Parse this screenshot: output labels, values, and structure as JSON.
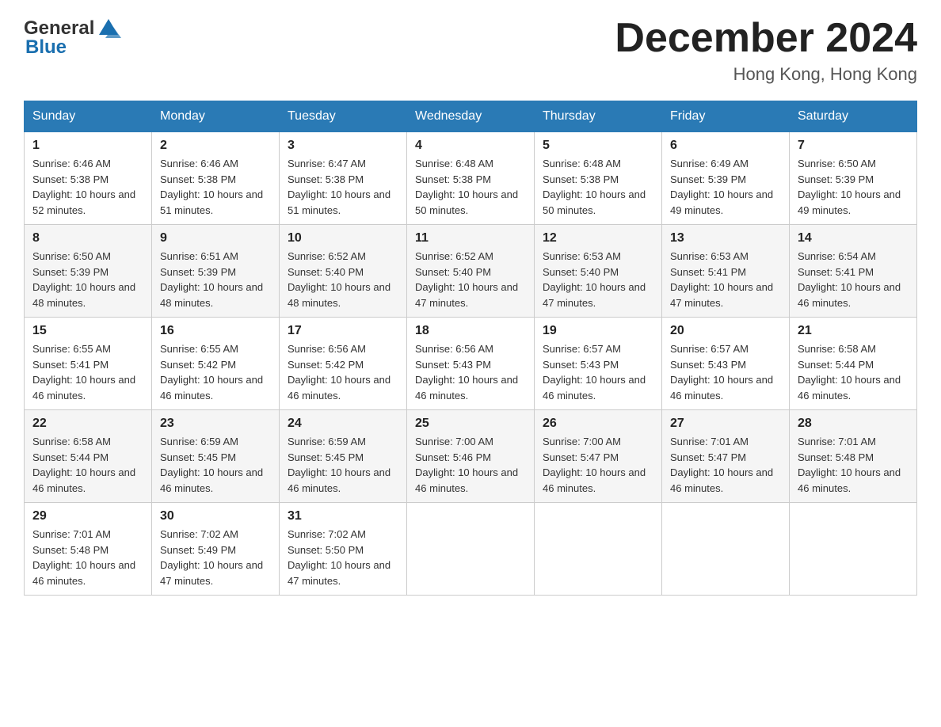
{
  "app": {
    "logo_general": "General",
    "logo_blue": "Blue",
    "month_title": "December 2024",
    "location": "Hong Kong, Hong Kong"
  },
  "calendar": {
    "days_of_week": [
      "Sunday",
      "Monday",
      "Tuesday",
      "Wednesday",
      "Thursday",
      "Friday",
      "Saturday"
    ],
    "weeks": [
      [
        {
          "day": "1",
          "sunrise": "6:46 AM",
          "sunset": "5:38 PM",
          "daylight": "10 hours and 52 minutes."
        },
        {
          "day": "2",
          "sunrise": "6:46 AM",
          "sunset": "5:38 PM",
          "daylight": "10 hours and 51 minutes."
        },
        {
          "day": "3",
          "sunrise": "6:47 AM",
          "sunset": "5:38 PM",
          "daylight": "10 hours and 51 minutes."
        },
        {
          "day": "4",
          "sunrise": "6:48 AM",
          "sunset": "5:38 PM",
          "daylight": "10 hours and 50 minutes."
        },
        {
          "day": "5",
          "sunrise": "6:48 AM",
          "sunset": "5:38 PM",
          "daylight": "10 hours and 50 minutes."
        },
        {
          "day": "6",
          "sunrise": "6:49 AM",
          "sunset": "5:39 PM",
          "daylight": "10 hours and 49 minutes."
        },
        {
          "day": "7",
          "sunrise": "6:50 AM",
          "sunset": "5:39 PM",
          "daylight": "10 hours and 49 minutes."
        }
      ],
      [
        {
          "day": "8",
          "sunrise": "6:50 AM",
          "sunset": "5:39 PM",
          "daylight": "10 hours and 48 minutes."
        },
        {
          "day": "9",
          "sunrise": "6:51 AM",
          "sunset": "5:39 PM",
          "daylight": "10 hours and 48 minutes."
        },
        {
          "day": "10",
          "sunrise": "6:52 AM",
          "sunset": "5:40 PM",
          "daylight": "10 hours and 48 minutes."
        },
        {
          "day": "11",
          "sunrise": "6:52 AM",
          "sunset": "5:40 PM",
          "daylight": "10 hours and 47 minutes."
        },
        {
          "day": "12",
          "sunrise": "6:53 AM",
          "sunset": "5:40 PM",
          "daylight": "10 hours and 47 minutes."
        },
        {
          "day": "13",
          "sunrise": "6:53 AM",
          "sunset": "5:41 PM",
          "daylight": "10 hours and 47 minutes."
        },
        {
          "day": "14",
          "sunrise": "6:54 AM",
          "sunset": "5:41 PM",
          "daylight": "10 hours and 46 minutes."
        }
      ],
      [
        {
          "day": "15",
          "sunrise": "6:55 AM",
          "sunset": "5:41 PM",
          "daylight": "10 hours and 46 minutes."
        },
        {
          "day": "16",
          "sunrise": "6:55 AM",
          "sunset": "5:42 PM",
          "daylight": "10 hours and 46 minutes."
        },
        {
          "day": "17",
          "sunrise": "6:56 AM",
          "sunset": "5:42 PM",
          "daylight": "10 hours and 46 minutes."
        },
        {
          "day": "18",
          "sunrise": "6:56 AM",
          "sunset": "5:43 PM",
          "daylight": "10 hours and 46 minutes."
        },
        {
          "day": "19",
          "sunrise": "6:57 AM",
          "sunset": "5:43 PM",
          "daylight": "10 hours and 46 minutes."
        },
        {
          "day": "20",
          "sunrise": "6:57 AM",
          "sunset": "5:43 PM",
          "daylight": "10 hours and 46 minutes."
        },
        {
          "day": "21",
          "sunrise": "6:58 AM",
          "sunset": "5:44 PM",
          "daylight": "10 hours and 46 minutes."
        }
      ],
      [
        {
          "day": "22",
          "sunrise": "6:58 AM",
          "sunset": "5:44 PM",
          "daylight": "10 hours and 46 minutes."
        },
        {
          "day": "23",
          "sunrise": "6:59 AM",
          "sunset": "5:45 PM",
          "daylight": "10 hours and 46 minutes."
        },
        {
          "day": "24",
          "sunrise": "6:59 AM",
          "sunset": "5:45 PM",
          "daylight": "10 hours and 46 minutes."
        },
        {
          "day": "25",
          "sunrise": "7:00 AM",
          "sunset": "5:46 PM",
          "daylight": "10 hours and 46 minutes."
        },
        {
          "day": "26",
          "sunrise": "7:00 AM",
          "sunset": "5:47 PM",
          "daylight": "10 hours and 46 minutes."
        },
        {
          "day": "27",
          "sunrise": "7:01 AM",
          "sunset": "5:47 PM",
          "daylight": "10 hours and 46 minutes."
        },
        {
          "day": "28",
          "sunrise": "7:01 AM",
          "sunset": "5:48 PM",
          "daylight": "10 hours and 46 minutes."
        }
      ],
      [
        {
          "day": "29",
          "sunrise": "7:01 AM",
          "sunset": "5:48 PM",
          "daylight": "10 hours and 46 minutes."
        },
        {
          "day": "30",
          "sunrise": "7:02 AM",
          "sunset": "5:49 PM",
          "daylight": "10 hours and 47 minutes."
        },
        {
          "day": "31",
          "sunrise": "7:02 AM",
          "sunset": "5:50 PM",
          "daylight": "10 hours and 47 minutes."
        },
        null,
        null,
        null,
        null
      ]
    ]
  }
}
